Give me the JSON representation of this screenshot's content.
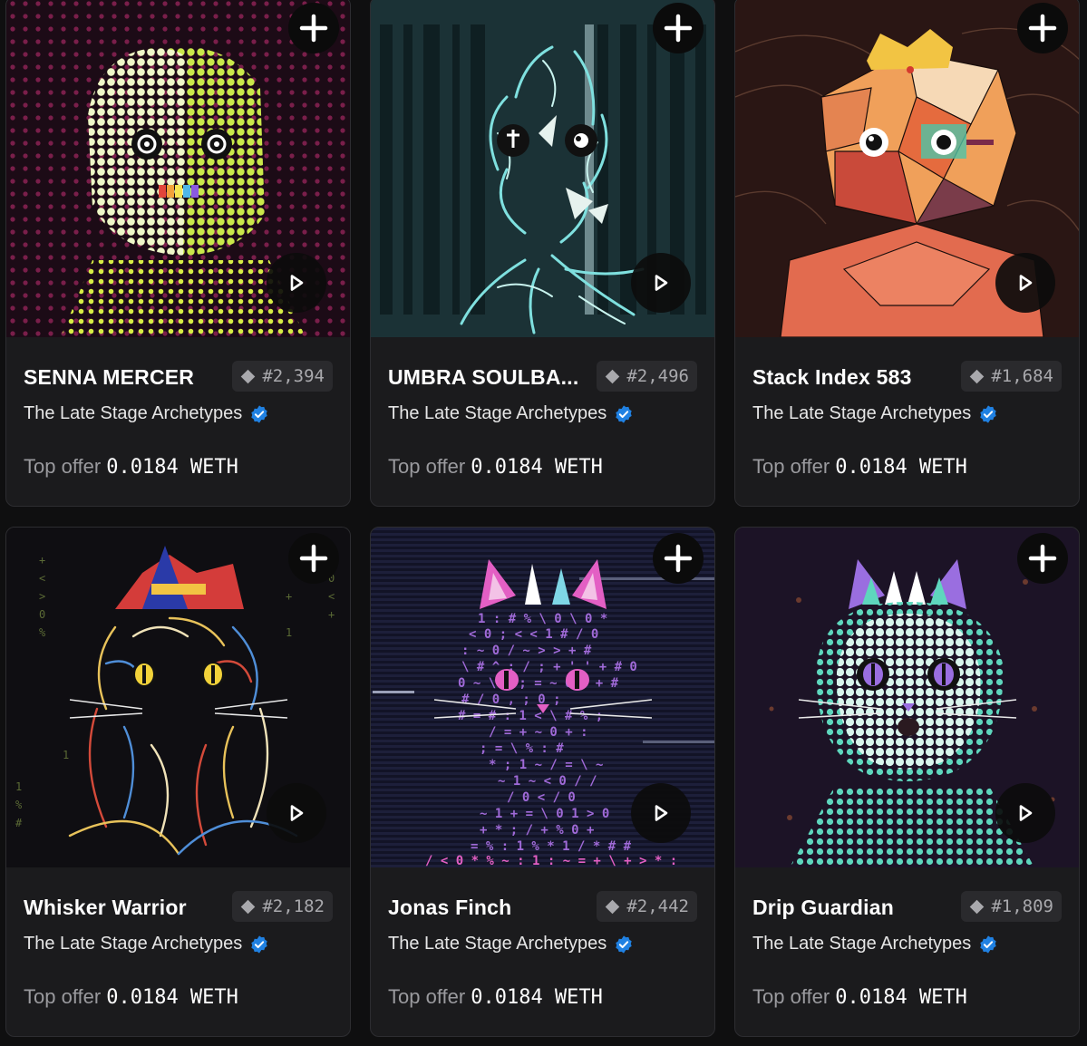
{
  "cards": [
    {
      "name": "SENNA MERCER",
      "rank": "#2,394",
      "collection": "The Late Stage Archetypes",
      "offer_label": "Top offer",
      "offer_value": "0.0184 WETH"
    },
    {
      "name": "UMBRA SOULBA...",
      "rank": "#2,496",
      "collection": "The Late Stage Archetypes",
      "offer_label": "Top offer",
      "offer_value": "0.0184 WETH"
    },
    {
      "name": "Stack Index 583",
      "rank": "#1,684",
      "collection": "The Late Stage Archetypes",
      "offer_label": "Top offer",
      "offer_value": "0.0184 WETH"
    },
    {
      "name": "Whisker Warrior",
      "rank": "#2,182",
      "collection": "The Late Stage Archetypes",
      "offer_label": "Top offer",
      "offer_value": "0.0184 WETH"
    },
    {
      "name": "Jonas Finch",
      "rank": "#2,442",
      "collection": "The Late Stage Archetypes",
      "offer_label": "Top offer",
      "offer_value": "0.0184 WETH"
    },
    {
      "name": "Drip Guardian",
      "rank": "#1,809",
      "collection": "The Late Stage Archetypes",
      "offer_label": "Top offer",
      "offer_value": "0.0184 WETH"
    }
  ],
  "icons": {
    "add": "plus-icon",
    "play": "play-icon",
    "rank": "diamond-icon",
    "verified": "verified-badge-icon"
  },
  "colors": {
    "card_bg": "#1b1b1d",
    "page_bg": "#0f0f10",
    "verified_blue": "#2081e2",
    "muted_text": "#9a9a9e"
  }
}
